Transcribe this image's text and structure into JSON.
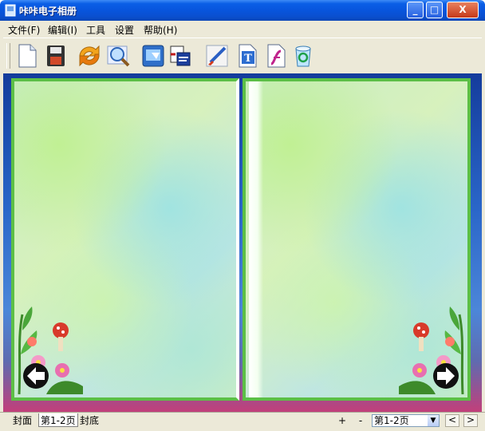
{
  "window": {
    "title": "咔咔电子相册",
    "min_label": "_",
    "max_label": "□",
    "close_label": "X"
  },
  "menu": [
    {
      "label": "文件(F)"
    },
    {
      "label": "编辑(I)"
    },
    {
      "label": "工具"
    },
    {
      "label": "设置"
    },
    {
      "label": "帮助(H)"
    }
  ],
  "toolbar": {
    "tools": [
      {
        "icon": "new-document-icon"
      },
      {
        "icon": "save-disk-icon"
      },
      {
        "icon": "refresh-arrows-icon"
      },
      {
        "icon": "zoom-magnifier-icon"
      },
      {
        "icon": "screen-capture-icon"
      },
      {
        "icon": "export-icon"
      },
      {
        "icon": "paint-brush-icon"
      },
      {
        "icon": "text-tool-icon"
      },
      {
        "icon": "flash-icon"
      },
      {
        "icon": "recycle-bin-icon"
      }
    ]
  },
  "colors": {
    "page_border": "#5cbf46",
    "titlebar": "#0855dd"
  },
  "tabs": [
    {
      "label": "封面",
      "active": false
    },
    {
      "label": "第1-2页",
      "active": true
    },
    {
      "label": "封底",
      "active": false
    }
  ],
  "bottom": {
    "zoom_in_label": "+",
    "zoom_out_label": "-",
    "page_select_value": "第1-2页",
    "prev_label": "<",
    "next_label": ">"
  }
}
